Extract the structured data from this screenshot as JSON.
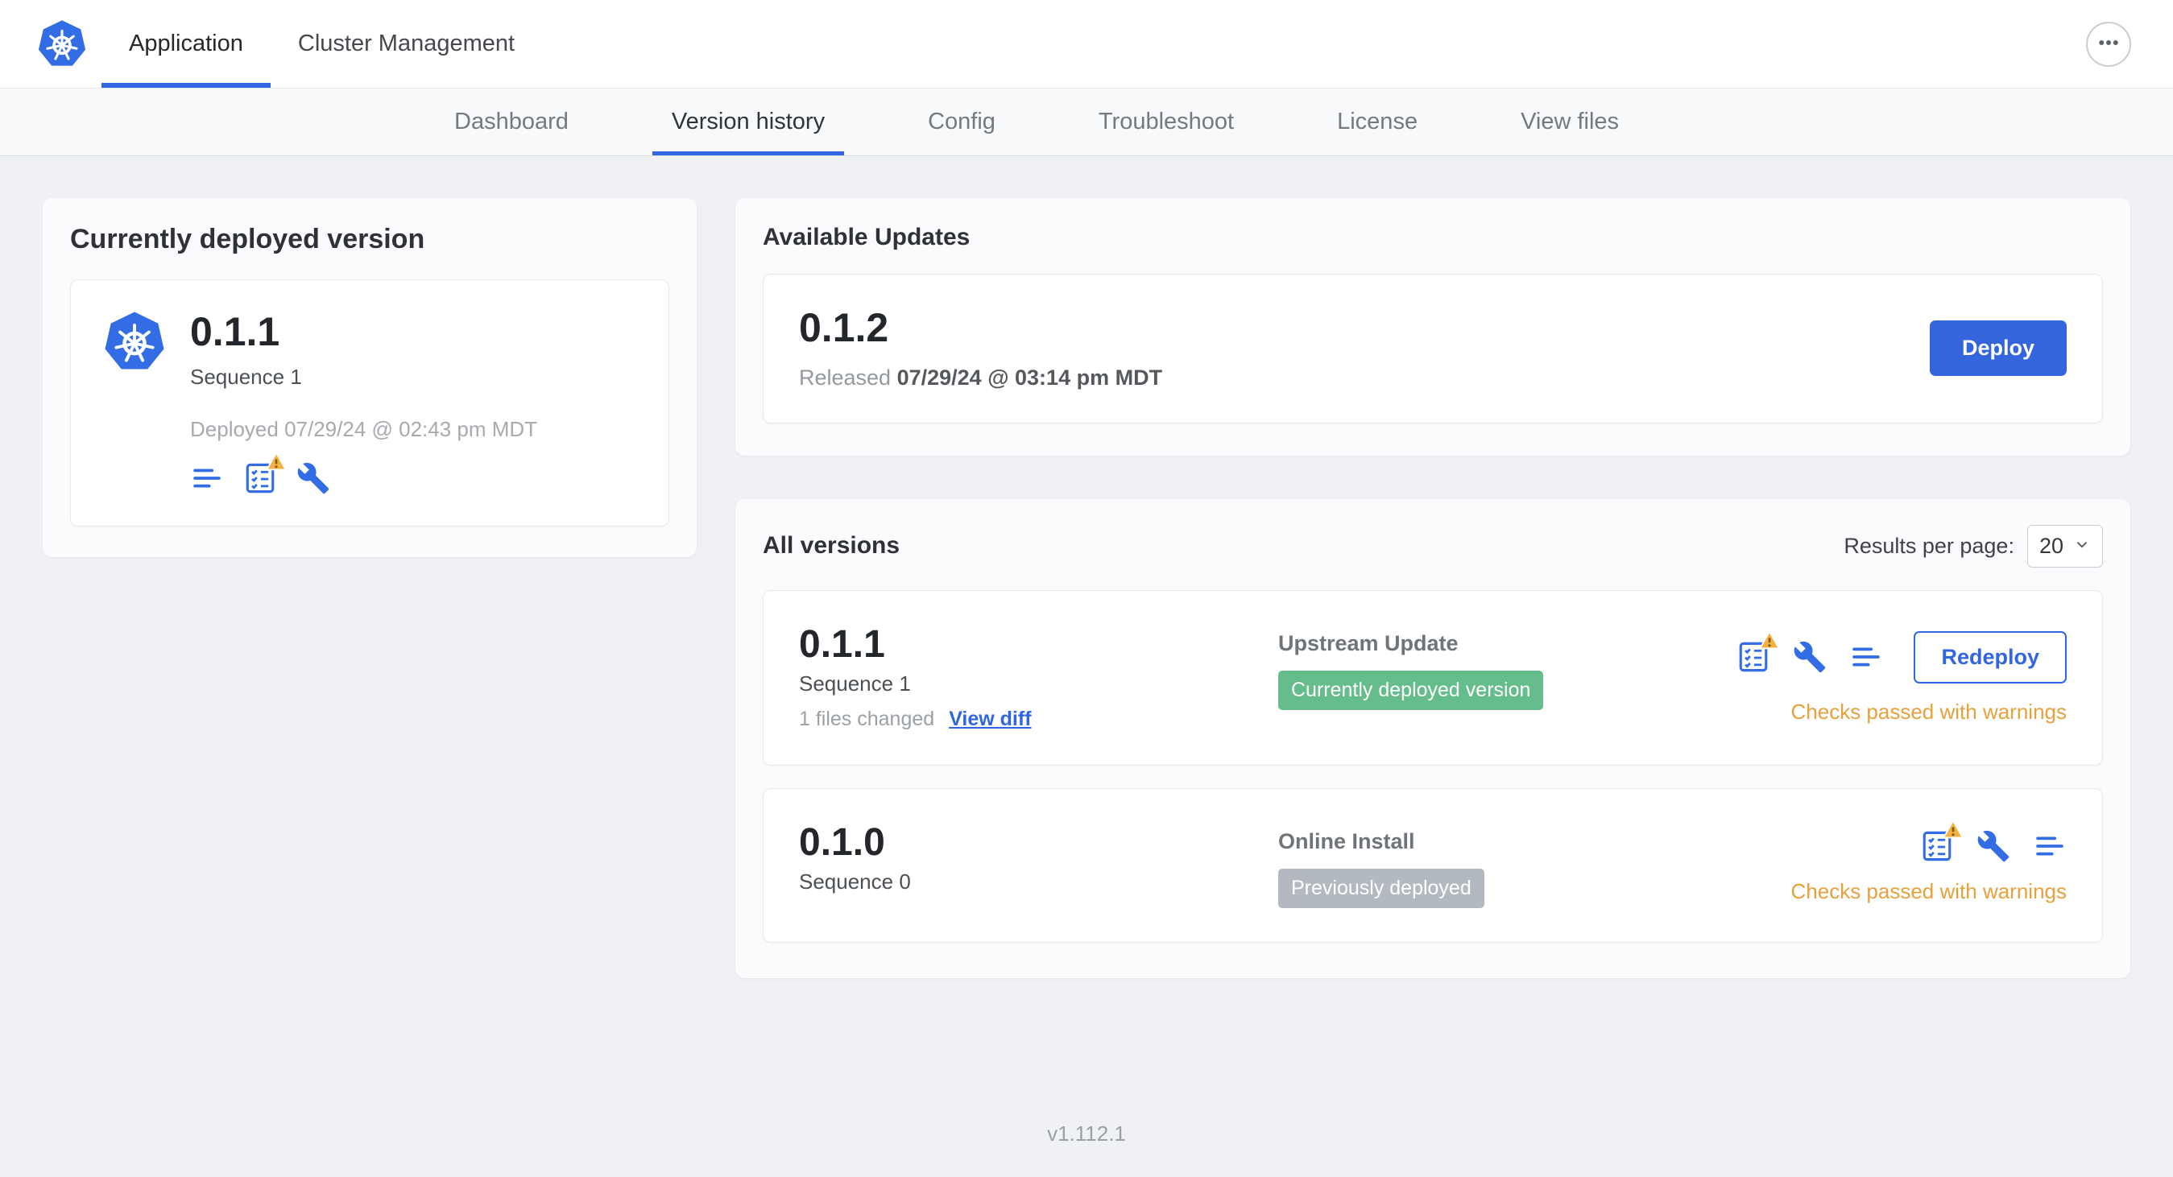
{
  "colors": {
    "accent_blue": "#326de6",
    "link_blue": "#3066e0",
    "primary_button_blue": "#3465dc",
    "badge_green": "#65bd8b",
    "badge_gray": "#b2b9c0",
    "warning_orange": "#e7a13c"
  },
  "top_nav": {
    "tabs": [
      {
        "label": "Application"
      },
      {
        "label": "Cluster Management"
      }
    ],
    "active_tab": "Application",
    "overflow_menu_icon": "ellipsis-icon"
  },
  "sub_nav": {
    "tabs": [
      {
        "label": "Dashboard"
      },
      {
        "label": "Version history"
      },
      {
        "label": "Config"
      },
      {
        "label": "Troubleshoot"
      },
      {
        "label": "License"
      },
      {
        "label": "View files"
      }
    ],
    "active_tab": "Version history"
  },
  "deployed_card": {
    "title": "Currently deployed version",
    "version": "0.1.1",
    "sequence": "Sequence 1",
    "deployed_text": "Deployed 07/29/24 @ 02:43 pm MDT",
    "icons": [
      "release-notes-icon",
      "preflight-checks-warning-icon",
      "config-wrench-icon"
    ]
  },
  "available_updates": {
    "title": "Available Updates",
    "version": "0.1.2",
    "released_label": "Released",
    "released_date": "07/29/24 @ 03:14 pm MDT",
    "deploy_button": "Deploy"
  },
  "all_versions": {
    "title": "All versions",
    "results_per_page_label": "Results per page:",
    "results_per_page_value": "20",
    "rows": [
      {
        "version": "0.1.1",
        "sequence": "Sequence 1",
        "files_changed": "1 files changed",
        "view_diff_link": "View diff",
        "source": "Upstream Update",
        "status_badge": "Currently deployed version",
        "badge_style": "green",
        "checks_text": "Checks passed with warnings",
        "action_button": "Redeploy"
      },
      {
        "version": "0.1.0",
        "sequence": "Sequence 0",
        "source": "Online Install",
        "status_badge": "Previously deployed",
        "badge_style": "gray",
        "checks_text": "Checks passed with warnings"
      }
    ]
  },
  "footer": {
    "app_version": "v1.112.1"
  }
}
